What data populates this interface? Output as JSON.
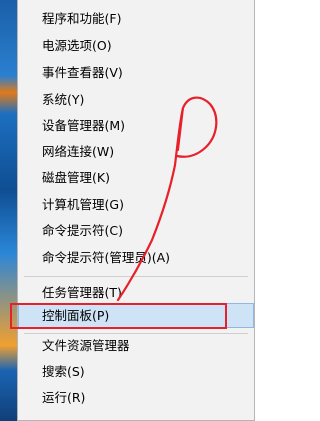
{
  "context_menu": {
    "items": [
      {
        "label": "程序和功能(F)"
      },
      {
        "label": "电源选项(O)"
      },
      {
        "label": "事件查看器(V)"
      },
      {
        "label": "系统(Y)"
      },
      {
        "label": "设备管理器(M)"
      },
      {
        "label": "网络连接(W)"
      },
      {
        "label": "磁盘管理(K)"
      },
      {
        "label": "计算机管理(G)"
      },
      {
        "label": "命令提示符(C)"
      },
      {
        "label": "命令提示符(管理员)(A)"
      },
      {
        "label": "任务管理器(T)"
      },
      {
        "label": "控制面板(P)"
      },
      {
        "label": "文件资源管理器"
      },
      {
        "label": "搜索(S)"
      },
      {
        "label": "运行(R)"
      }
    ],
    "highlighted_item": "控制面板(P)"
  },
  "annotation": {
    "color": "#e8202a"
  }
}
